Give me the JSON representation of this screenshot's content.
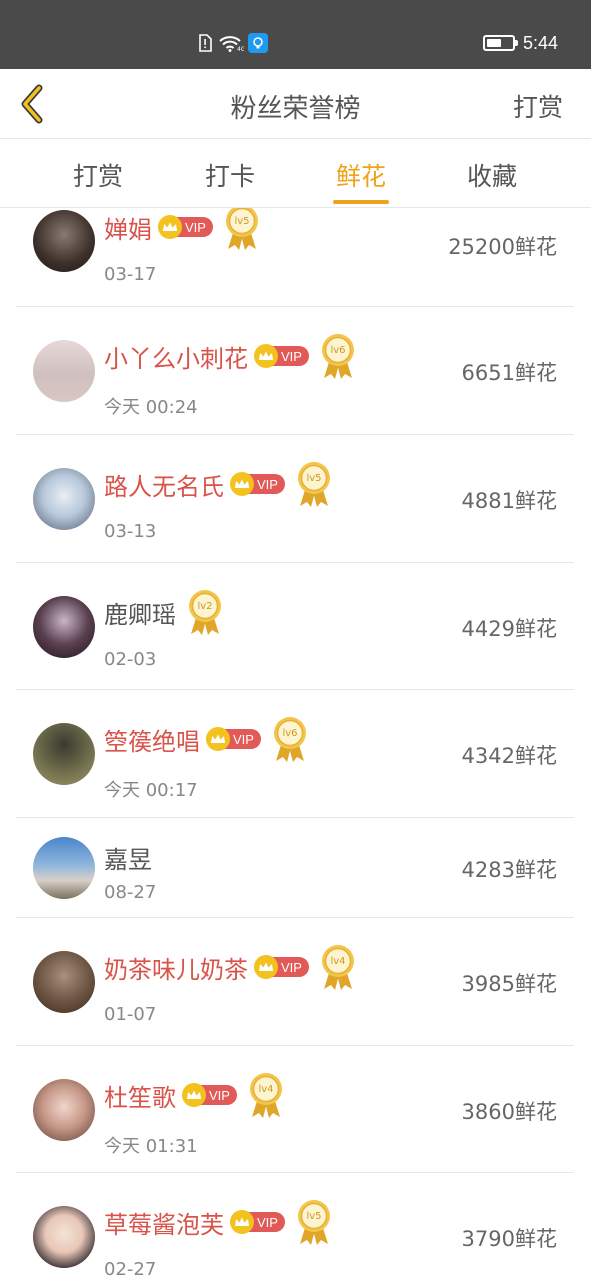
{
  "status_bar": {
    "time": "5:44",
    "battery_level": 0.6
  },
  "header": {
    "title": "粉丝荣誉榜",
    "action": "打赏"
  },
  "tabs": [
    {
      "label": "打赏",
      "active": false
    },
    {
      "label": "打卡",
      "active": false
    },
    {
      "label": "鲜花",
      "active": true
    },
    {
      "label": "收藏",
      "active": false
    }
  ],
  "rows": [
    {
      "name": "婵娟",
      "vip": true,
      "level": "lv5",
      "date": "03-17",
      "amount": "25200鲜花"
    },
    {
      "name": "小丫么小刺花",
      "vip": true,
      "level": "lv6",
      "date": "今天 00:24",
      "amount": "6651鲜花"
    },
    {
      "name": "路人无名氏",
      "vip": true,
      "level": "lv5",
      "date": "03-13",
      "amount": "4881鲜花"
    },
    {
      "name": "鹿卿瑶",
      "vip": false,
      "level": "lv2",
      "date": "02-03",
      "amount": "4429鲜花"
    },
    {
      "name": "箜篌绝唱",
      "vip": true,
      "level": "lv6",
      "date": "今天 00:17",
      "amount": "4342鲜花"
    },
    {
      "name": "嘉昱",
      "vip": false,
      "level": "",
      "date": "08-27",
      "amount": "4283鲜花"
    },
    {
      "name": "奶茶味儿奶茶",
      "vip": true,
      "level": "lv4",
      "date": "01-07",
      "amount": "3985鲜花"
    },
    {
      "name": "杜笙歌",
      "vip": true,
      "level": "lv4",
      "date": "今天 01:31",
      "amount": "3860鲜花"
    },
    {
      "name": "草莓酱泡芙",
      "vip": true,
      "level": "lv5",
      "date": "02-27",
      "amount": "3790鲜花"
    }
  ],
  "vip_label": "VIP",
  "colors": {
    "accent": "#f0a21b",
    "vip_name": "#d9534a",
    "status_bar": "#4a4a4a"
  }
}
